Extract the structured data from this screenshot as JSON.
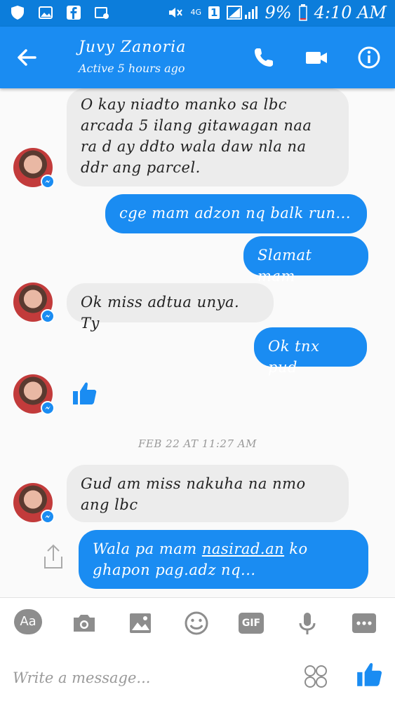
{
  "status_bar": {
    "network": "4G",
    "sim": "1",
    "battery": "9%",
    "time": "4:10 AM",
    "icons": [
      "shield-icon",
      "image-icon",
      "facebook-icon",
      "gallery-icon",
      "mute-icon",
      "signal-icon",
      "battery-icon"
    ]
  },
  "header": {
    "contact_name": "Juvy Zanoria",
    "contact_status": "Active 5 hours ago",
    "icons": [
      "back-arrow-icon",
      "phone-icon",
      "video-camera-icon",
      "info-icon"
    ]
  },
  "messages": [
    {
      "from": "contact",
      "text": "O kay niadto manko sa lbc\narcada 5 ilang gitawagan naa\nra d ay ddto wala daw nla na\nddr ang parcel."
    },
    {
      "from": "me",
      "text": "cge mam adzon nq balk run..."
    },
    {
      "from": "me",
      "text": "Slamat mam"
    },
    {
      "from": "contact",
      "text": "Ok miss adtua unya. Ty"
    },
    {
      "from": "me",
      "text": "Ok tnx pud"
    },
    {
      "from": "contact",
      "sticker": "like-icon"
    },
    {
      "from": "contact",
      "text": "Gud am miss nakuha na nmo\nang lbc"
    },
    {
      "from": "me",
      "text_parts": [
        "Wala pa mam ",
        "nasirad.an",
        " ko\nghapon pag.adz nq..."
      ]
    }
  ],
  "timestamp": "FEB 22 AT 11:27 AM",
  "composer": {
    "aa_label": "Aa",
    "gif_label": "GIF",
    "placeholder": "Write a message...",
    "icons": [
      "camera-icon",
      "image-icon",
      "emoji-icon",
      "microphone-icon",
      "more-icon",
      "stickers-icon",
      "like-icon"
    ]
  },
  "colors": {
    "brand_blue": "#1a8cf2",
    "status_bar_blue": "#0c7ddb",
    "incoming_bubble": "#ececec"
  }
}
